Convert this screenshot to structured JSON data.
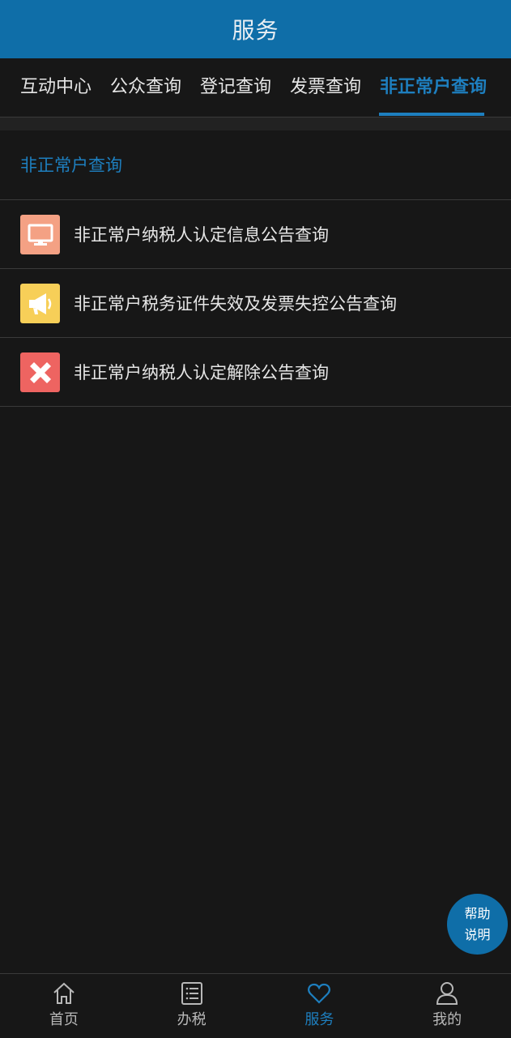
{
  "header": {
    "title": "服务"
  },
  "tabs": [
    {
      "label": "互动中心",
      "active": false
    },
    {
      "label": "公众查询",
      "active": false
    },
    {
      "label": "登记查询",
      "active": false
    },
    {
      "label": "发票查询",
      "active": false
    },
    {
      "label": "非正常户查询",
      "active": true
    }
  ],
  "section": {
    "title": "非正常户查询"
  },
  "items": [
    {
      "label": "非正常户纳税人认定信息公告查询",
      "icon": "monitor-icon",
      "color": "#f4a184"
    },
    {
      "label": "非正常户税务证件失效及发票失控公告查询",
      "icon": "megaphone-icon",
      "color": "#f7cf58"
    },
    {
      "label": "非正常户纳税人认定解除公告查询",
      "icon": "close-icon",
      "color": "#ee6461"
    }
  ],
  "help": {
    "line1": "帮助",
    "line2": "说明"
  },
  "nav": [
    {
      "label": "首页",
      "icon": "home-icon",
      "active": false
    },
    {
      "label": "办税",
      "icon": "list-icon",
      "active": false
    },
    {
      "label": "服务",
      "icon": "heart-icon",
      "active": true
    },
    {
      "label": "我的",
      "icon": "user-icon",
      "active": false
    }
  ],
  "colors": {
    "header": "#0f6ea8",
    "accent": "#1e7fbf",
    "background": "#171717"
  }
}
